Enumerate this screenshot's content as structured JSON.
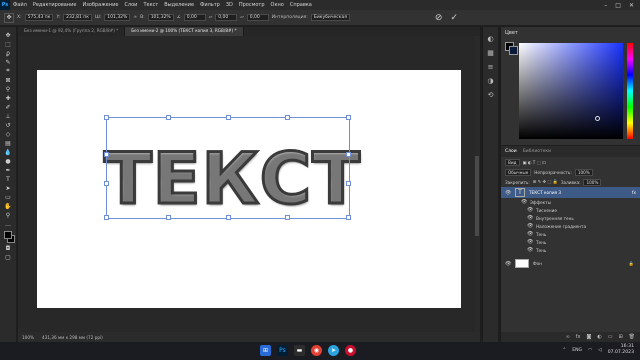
{
  "menubar": {
    "logo": "Ps",
    "items": [
      "Файл",
      "Редактирование",
      "Изображение",
      "Слои",
      "Текст",
      "Выделение",
      "Фильтр",
      "3D",
      "Просмотр",
      "Окно",
      "Справка"
    ]
  },
  "options": {
    "x_label": "X:",
    "x_value": "575,43 пк",
    "y_label": "Y:",
    "y_value": "232,81 пк",
    "w_label": "Ш:",
    "w_value": "101,32%",
    "h_label": "В:",
    "h_value": "101,32%",
    "angle_value": "0,00",
    "hskew_value": "0,00",
    "vskew_value": "0,00",
    "interp_label": "Интерполяция:",
    "interp_value": "Бикубическая"
  },
  "tabs": [
    {
      "label": "Без имени-1 @ 92,4% (Группа 2, RGB/8#) *"
    },
    {
      "label": "Без имени-2 @ 100% (ТЕКСТ копия 3, RGB/8#) *"
    }
  ],
  "canvas": {
    "text": "ТЕКСТ"
  },
  "status": {
    "zoom": "100%",
    "doc": "431,36 мм x 298 мм (72 ppi)"
  },
  "color_panel": {
    "title": "Цвет"
  },
  "layers_panel": {
    "tabs": [
      "Слои",
      "Библиотеки"
    ],
    "search": "Вид",
    "blend_mode": "Обычные",
    "opacity_label": "Непрозрачность:",
    "opacity_value": "100%",
    "lock_label": "Закрепить:",
    "fill_label": "Заливка:",
    "fill_value": "100%",
    "layers": [
      {
        "name": "ТЕКСТ копия 3",
        "fx": "fx"
      },
      {
        "name": "Эффекты"
      },
      {
        "name": "Тиснение"
      },
      {
        "name": "Внутренняя тень"
      },
      {
        "name": "Наложение градиента"
      },
      {
        "name": "Тень"
      },
      {
        "name": "Тень"
      },
      {
        "name": "Тень"
      },
      {
        "name": "Фон"
      }
    ]
  },
  "taskbar": {
    "lang": "ENG",
    "time": "16:31",
    "date": "07.07.2023"
  },
  "colors": {
    "accent": "#31a8ff",
    "selected_layer": "#3e5a86",
    "bbox": "#6f8fd6"
  }
}
